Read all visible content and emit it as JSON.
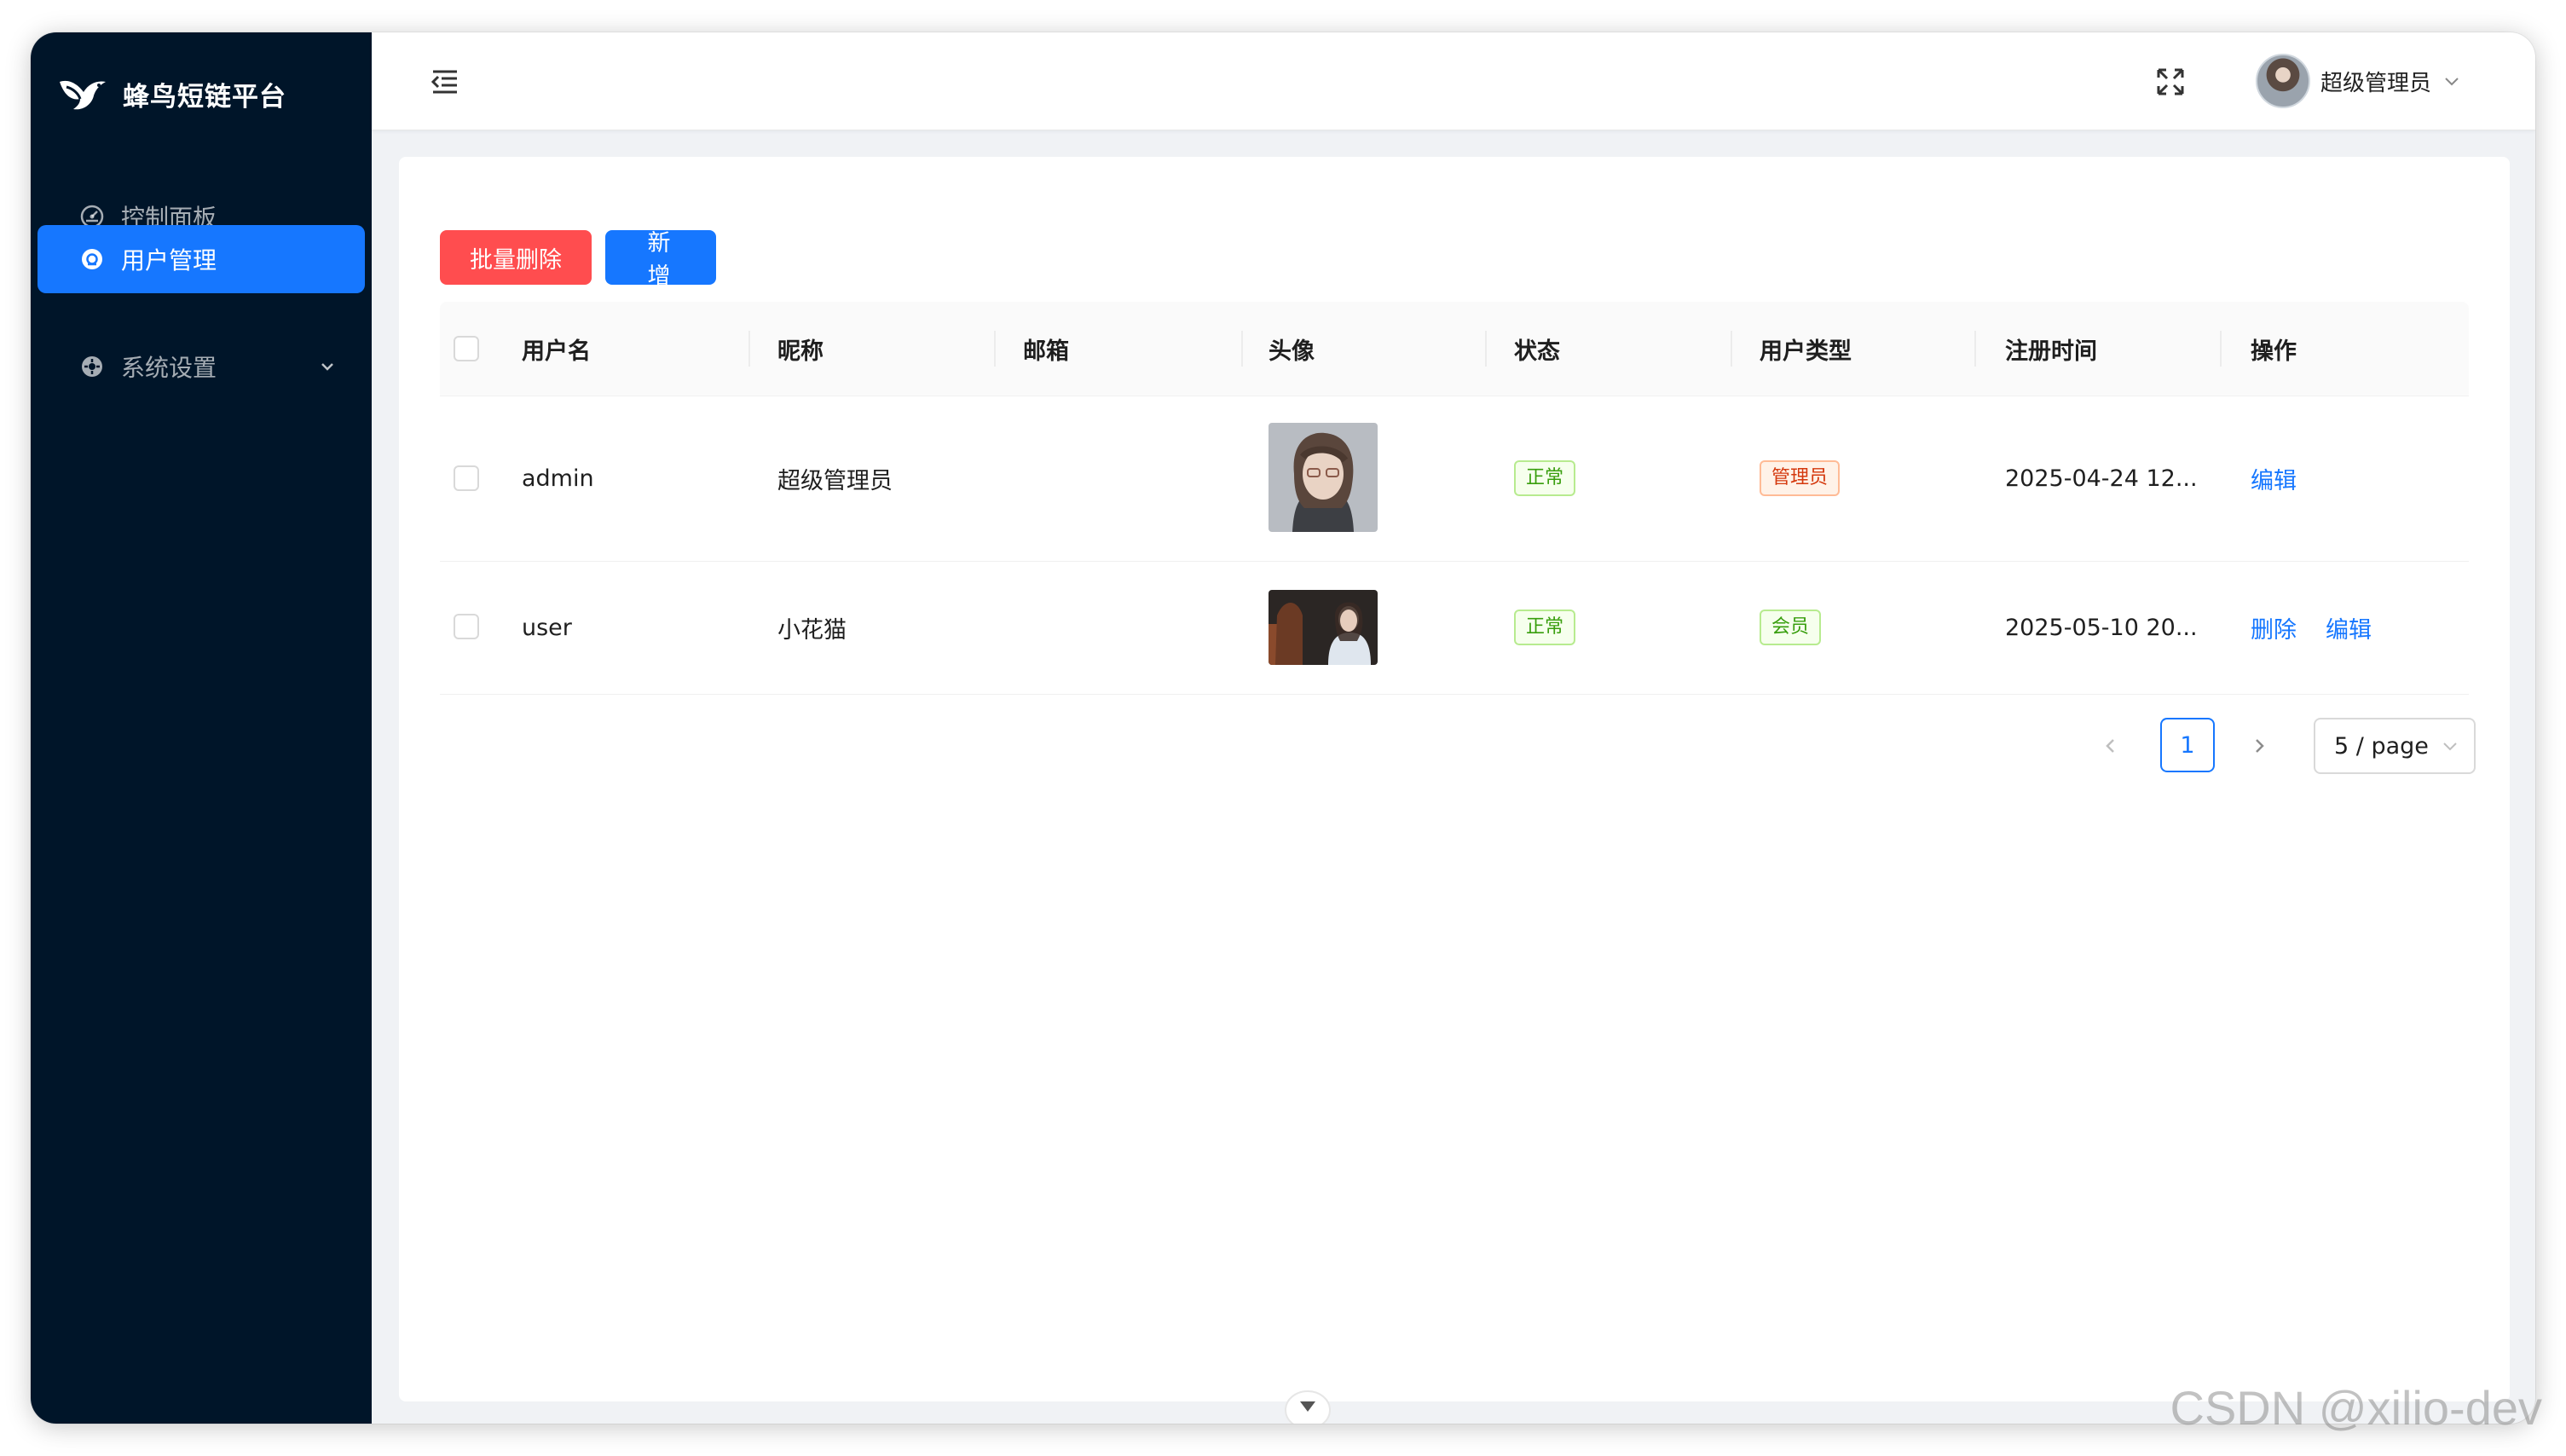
{
  "app": {
    "brand_name": "蜂鸟短链平台"
  },
  "sidebar": {
    "items": [
      {
        "label": "控制面板",
        "icon": "dashboard-icon",
        "active": false
      },
      {
        "label": "用户管理",
        "icon": "user-icon",
        "active": true
      },
      {
        "label": "系统设置",
        "icon": "settings-icon",
        "active": false,
        "expandable": true
      }
    ]
  },
  "header": {
    "user_name": "超级管理员"
  },
  "toolbar": {
    "batch_delete_label": "批量删除",
    "add_label": "新 增"
  },
  "table": {
    "columns": [
      "用户名",
      "昵称",
      "邮箱",
      "头像",
      "状态",
      "用户类型",
      "注册时间",
      "操作"
    ],
    "rows": [
      {
        "username": "admin",
        "nickname": "超级管理员",
        "email": "",
        "status": "正常",
        "user_type": "管理员",
        "registered": "2025-04-24 12...",
        "actions": [
          "编辑"
        ]
      },
      {
        "username": "user",
        "nickname": "小花猫",
        "email": "",
        "status": "正常",
        "user_type": "会员",
        "registered": "2025-05-10 20...",
        "actions": [
          "删除",
          "编辑"
        ]
      }
    ]
  },
  "pagination": {
    "current_page": "1",
    "page_size_label": "5 / page"
  },
  "colors": {
    "sidebar_bg": "#001529",
    "primary": "#1677ff",
    "danger": "#ff4d4f",
    "success": "#389e0d",
    "warning": "#d4380d"
  },
  "watermark": "CSDN @xilio-dev"
}
